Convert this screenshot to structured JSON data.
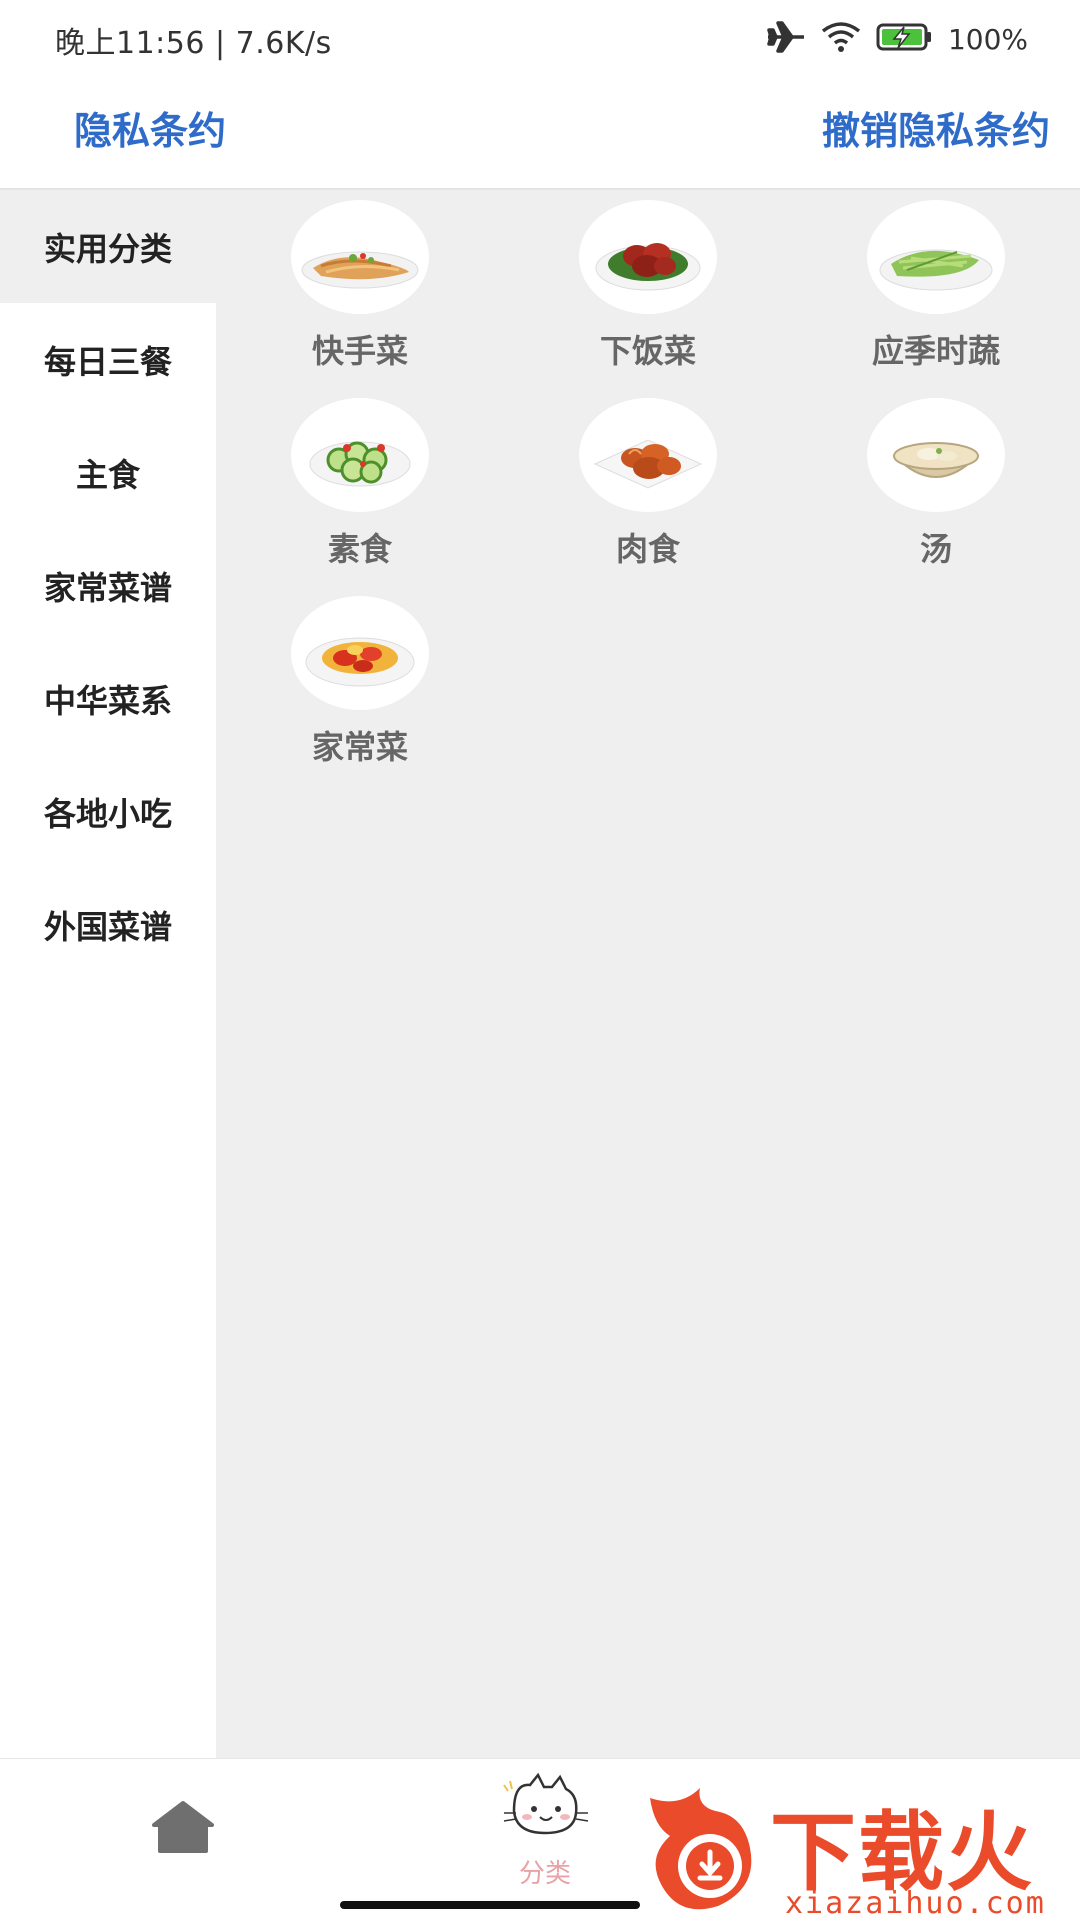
{
  "status_bar": {
    "time": "晚上11:56 | 7.6K/s",
    "battery": "100%",
    "icons": [
      "airplane-mode-icon",
      "wifi-icon",
      "battery-charging-icon"
    ]
  },
  "header": {
    "privacy_link": "隐私条约",
    "revoke_privacy_link": "撤销隐私条约"
  },
  "sidebar": {
    "items": [
      {
        "label": "实用分类",
        "active": true
      },
      {
        "label": "每日三餐",
        "active": false
      },
      {
        "label": "主食",
        "active": false
      },
      {
        "label": "家常菜谱",
        "active": false
      },
      {
        "label": "中华菜系",
        "active": false
      },
      {
        "label": "各地小吃",
        "active": false
      },
      {
        "label": "外国菜谱",
        "active": false
      }
    ]
  },
  "categories": [
    {
      "label": "快手菜",
      "image": "noodle-dish-image"
    },
    {
      "label": "下饭菜",
      "image": "braised-meat-dish-image"
    },
    {
      "label": "应季时蔬",
      "image": "green-vegetable-dish-image"
    },
    {
      "label": "素食",
      "image": "cucumber-dish-image"
    },
    {
      "label": "肉食",
      "image": "shrimp-dish-image"
    },
    {
      "label": "汤",
      "image": "soup-dish-image"
    },
    {
      "label": "家常菜",
      "image": "tomato-egg-dish-image"
    }
  ],
  "bottom_nav": {
    "home_icon": "home-icon",
    "category_label": "分类",
    "category_icon": "cat-face-icon"
  },
  "watermark": {
    "title": "下载火",
    "url": "xiazaihuo.com"
  },
  "colors": {
    "accent": "#2f6bc9",
    "content_bg": "#efefef",
    "active_tab": "#e9a2a6",
    "watermark": "#ea4b2a"
  }
}
